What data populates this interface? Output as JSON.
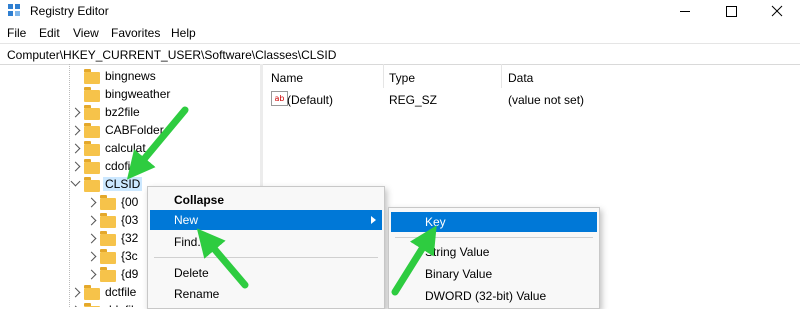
{
  "window": {
    "title": "Registry Editor"
  },
  "menubar": {
    "items": [
      "File",
      "Edit",
      "View",
      "Favorites",
      "Help"
    ]
  },
  "address": {
    "path": "Computer\\HKEY_CURRENT_USER\\Software\\Classes\\CLSID"
  },
  "tree": {
    "items": [
      {
        "label": "bingnews",
        "expander": "none"
      },
      {
        "label": "bingweather",
        "expander": "none"
      },
      {
        "label": "bz2file",
        "expander": "collapsed"
      },
      {
        "label": "CABFolder",
        "expander": "collapsed"
      },
      {
        "label": "calculat",
        "expander": "collapsed"
      },
      {
        "label": "cdofi",
        "expander": "collapsed"
      },
      {
        "label": "CLSID",
        "expander": "expanded",
        "selected": true
      },
      {
        "label": "{00",
        "expander": "collapsed"
      },
      {
        "label": "{03",
        "expander": "collapsed"
      },
      {
        "label": "{32",
        "expander": "collapsed"
      },
      {
        "label": "{3c",
        "expander": "collapsed"
      },
      {
        "label": "{d9",
        "expander": "collapsed"
      },
      {
        "label": "dctfile",
        "expander": "collapsed"
      },
      {
        "label": "ddpfil",
        "expander": "collapsed"
      }
    ]
  },
  "list": {
    "columns": [
      "Name",
      "Type",
      "Data"
    ],
    "rows": [
      {
        "name": "(Default)",
        "type": "REG_SZ",
        "data": "(value not set)"
      }
    ]
  },
  "context_menu": {
    "items": [
      {
        "label": "Collapse",
        "bold": true
      },
      {
        "label": "New",
        "highlighted": true,
        "has_submenu": true
      },
      {
        "label": "Find..."
      },
      {
        "label": "Delete"
      },
      {
        "label": "Rename"
      }
    ]
  },
  "submenu": {
    "items": [
      {
        "label": "Key",
        "highlighted": true
      },
      {
        "label": "String Value"
      },
      {
        "label": "Binary Value"
      },
      {
        "label": "DWORD (32-bit) Value"
      }
    ]
  },
  "colors": {
    "highlight": "#0078d7",
    "tree_selection": "#cce8ff",
    "folder": "#f6c34a",
    "annotation_arrow": "#2ecc40"
  },
  "icons": {
    "app": "registry-icon",
    "value": "string-value-icon",
    "tree_node": "folder-icon"
  }
}
